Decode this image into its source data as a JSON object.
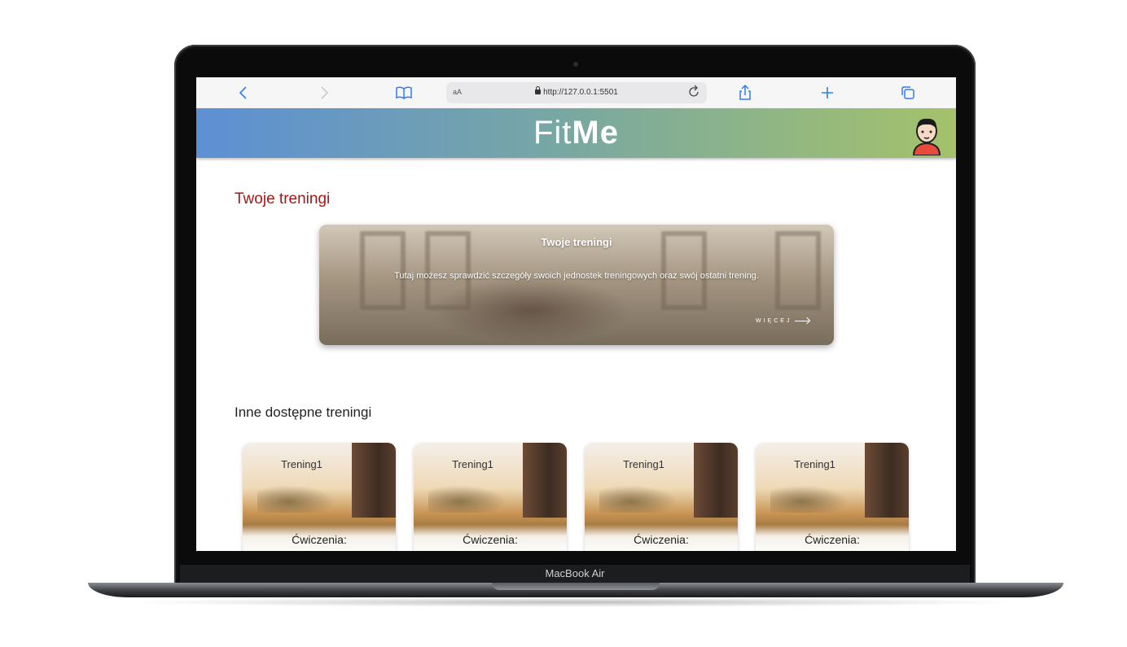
{
  "browser": {
    "url_prefix": "aA",
    "url": "http://127.0.0.1:5501"
  },
  "app": {
    "logo_thin": "Fit",
    "logo_bold": "Me"
  },
  "main": {
    "section_title": "Twoje treningi",
    "hero": {
      "title": "Twoje treningi",
      "description": "Tutaj możesz sprawdzić szczegóły swoich jednostek treningowych oraz swój ostatni trening.",
      "more_label": "WIĘCEJ"
    },
    "other_title": "Inne dostępne treningi",
    "cards": [
      {
        "title": "Trening1",
        "subtitle": "Ćwiczenia:"
      },
      {
        "title": "Trening1",
        "subtitle": "Ćwiczenia:"
      },
      {
        "title": "Trening1",
        "subtitle": "Ćwiczenia:"
      },
      {
        "title": "Trening1",
        "subtitle": "Ćwiczenia:"
      }
    ]
  },
  "device": {
    "label": "MacBook Air"
  },
  "icons": {
    "back": "chevron-left-icon",
    "forward": "chevron-right-icon",
    "bookmarks": "book-icon",
    "reload": "reload-icon",
    "share": "share-icon",
    "new_tab": "plus-icon",
    "tabs": "tabs-icon",
    "profile": "user-avatar-icon"
  },
  "colors": {
    "accent": "#2f7cf6",
    "title_red": "#a01818",
    "header_start": "#5d8fd4",
    "header_end": "#a4c26a"
  }
}
